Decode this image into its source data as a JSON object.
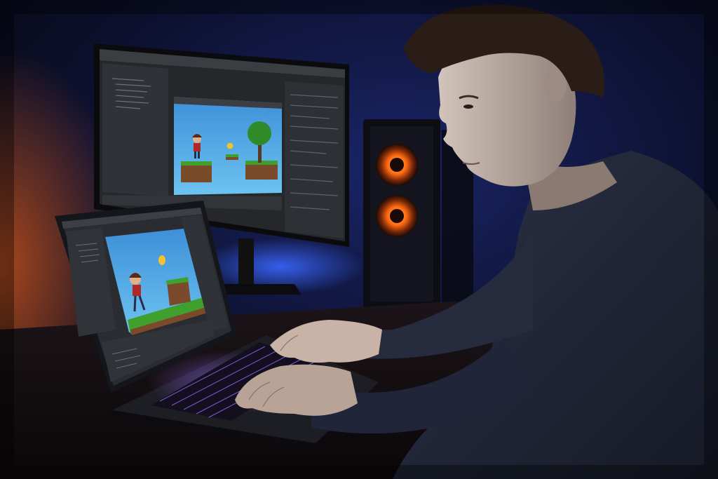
{
  "scene": {
    "subjects": [
      "monitor",
      "laptop",
      "pc-tower",
      "person",
      "desk"
    ],
    "palette": {
      "background": "#0c0f24",
      "ambient_blue": "#1e3ab8",
      "ambient_orange": "#c4521c",
      "editor_panel": "#2b2e33",
      "game_sky": "#4aa8e6",
      "grass": "#3fa02e",
      "dirt": "#7a4a2a",
      "coin": "#f2c230",
      "shirt": "#23283a",
      "skin": "#b8a89c",
      "hair": "#2a1c16",
      "keyboard_glow": "#9b6bff",
      "fan_glow": "#ff7a1a"
    }
  }
}
